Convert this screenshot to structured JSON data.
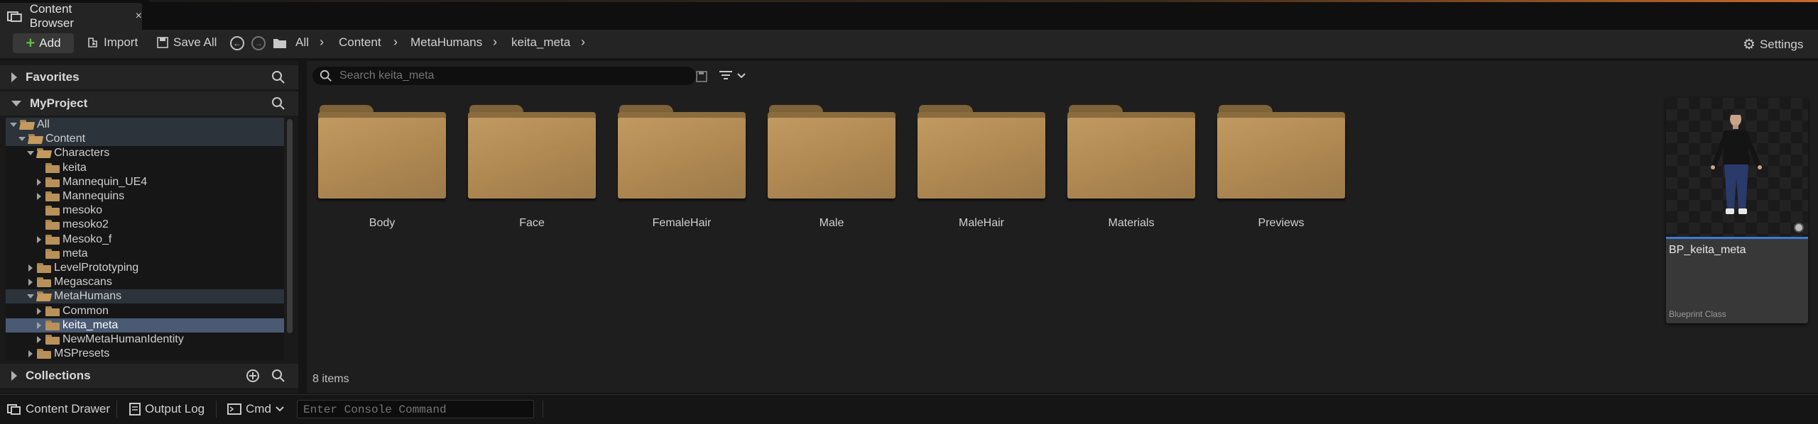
{
  "tab": {
    "title": "Content Browser",
    "close": "×"
  },
  "toolbar": {
    "add_label": "Add",
    "import_label": "Import",
    "save_all_label": "Save All",
    "settings_label": "Settings",
    "breadcrumbs": [
      "All",
      "Content",
      "MetaHumans",
      "keita_meta"
    ]
  },
  "left": {
    "favorites_title": "Favorites",
    "project_title": "MyProject",
    "collections_title": "Collections",
    "tree": [
      {
        "label": "All",
        "depth": 0,
        "expand": "open",
        "state": "hl"
      },
      {
        "label": "Content",
        "depth": 1,
        "expand": "open",
        "state": "hl"
      },
      {
        "label": "Characters",
        "depth": 2,
        "expand": "open",
        "state": ""
      },
      {
        "label": "keita",
        "depth": 3,
        "expand": "none",
        "state": ""
      },
      {
        "label": "Mannequin_UE4",
        "depth": 3,
        "expand": "closed",
        "state": ""
      },
      {
        "label": "Mannequins",
        "depth": 3,
        "expand": "closed",
        "state": ""
      },
      {
        "label": "mesoko",
        "depth": 3,
        "expand": "none",
        "state": ""
      },
      {
        "label": "mesoko2",
        "depth": 3,
        "expand": "none",
        "state": ""
      },
      {
        "label": "Mesoko_f",
        "depth": 3,
        "expand": "closed",
        "state": ""
      },
      {
        "label": "meta",
        "depth": 3,
        "expand": "none",
        "state": ""
      },
      {
        "label": "LevelPrototyping",
        "depth": 2,
        "expand": "closed",
        "state": ""
      },
      {
        "label": "Megascans",
        "depth": 2,
        "expand": "closed",
        "state": ""
      },
      {
        "label": "MetaHumans",
        "depth": 2,
        "expand": "open",
        "state": "hl"
      },
      {
        "label": "Common",
        "depth": 3,
        "expand": "closed",
        "state": ""
      },
      {
        "label": "keita_meta",
        "depth": 3,
        "expand": "closed",
        "state": "sel"
      },
      {
        "label": "NewMetaHumanIdentity",
        "depth": 3,
        "expand": "closed",
        "state": ""
      },
      {
        "label": "MSPresets",
        "depth": 2,
        "expand": "closed",
        "state": ""
      }
    ]
  },
  "main": {
    "search_placeholder": "Search keita_meta",
    "folders": [
      "Body",
      "Face",
      "FemaleHair",
      "Male",
      "MaleHair",
      "Materials",
      "Previews"
    ],
    "asset": {
      "name": "BP_keita_meta",
      "class": "Blueprint Class"
    },
    "item_count": "8 items"
  },
  "statusbar": {
    "content_drawer": "Content Drawer",
    "output_log": "Output Log",
    "cmd": "Cmd",
    "console_placeholder": "Enter Console Command"
  },
  "colors": {
    "accent_blue": "#3a7bd5",
    "add_green": "#5fbf3f",
    "folder": "#b8915a",
    "selection": "#4a5a73"
  }
}
